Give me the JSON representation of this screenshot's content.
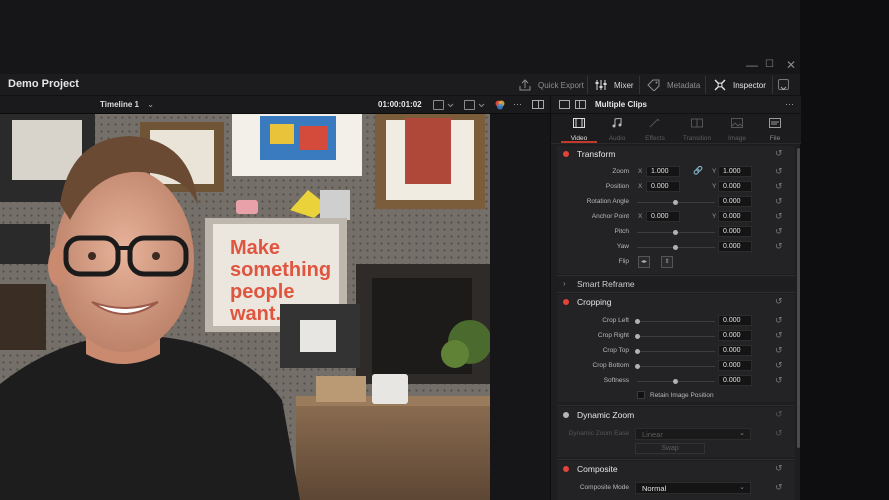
{
  "window": {
    "minimize": "—",
    "maximize": "☐",
    "close": "✕"
  },
  "header": {
    "project_title": "Demo Project",
    "quick_export": "Quick Export",
    "mixer": "Mixer",
    "metadata": "Metadata",
    "inspector": "Inspector"
  },
  "viewer": {
    "timeline_name": "Timeline 1",
    "timeline_chevron": "⌄",
    "timecode": "01:00:01:02",
    "more": "···",
    "poster_text": [
      "Make",
      "something",
      "people",
      "want."
    ]
  },
  "inspector": {
    "title": "Multiple Clips",
    "more": "···",
    "tabs": [
      {
        "label": "Video",
        "active": true
      },
      {
        "label": "Audio",
        "active": false
      },
      {
        "label": "Effects",
        "active": false
      },
      {
        "label": "Transition",
        "active": false
      },
      {
        "label": "Image",
        "active": false
      },
      {
        "label": "File",
        "active": false
      }
    ],
    "transform": {
      "label": "Transform",
      "zoom": {
        "label": "Zoom",
        "x_axis": "X",
        "x": "1.000",
        "y_axis": "Y",
        "y": "1.000"
      },
      "position": {
        "label": "Position",
        "x_axis": "X",
        "x": "0.000",
        "y_axis": "Y",
        "y": "0.000"
      },
      "rotation": {
        "label": "Rotation Angle",
        "value": "0.000"
      },
      "anchor": {
        "label": "Anchor Point",
        "x_axis": "X",
        "x": "0.000",
        "y_axis": "Y",
        "y": "0.000"
      },
      "pitch": {
        "label": "Pitch",
        "value": "0.000"
      },
      "yaw": {
        "label": "Yaw",
        "value": "0.000"
      },
      "flip": {
        "label": "Flip"
      }
    },
    "smart_reframe": {
      "label": "Smart Reframe"
    },
    "cropping": {
      "label": "Cropping",
      "crop_left": {
        "label": "Crop Left",
        "value": "0.000"
      },
      "crop_right": {
        "label": "Crop Right",
        "value": "0.000"
      },
      "crop_top": {
        "label": "Crop Top",
        "value": "0.000"
      },
      "crop_bottom": {
        "label": "Crop Bottom",
        "value": "0.000"
      },
      "softness": {
        "label": "Softness",
        "value": "0.000"
      },
      "retain": "Retain Image Position"
    },
    "dynamic_zoom": {
      "label": "Dynamic Zoom",
      "ease_label": "Dynamic Zoom Ease",
      "ease_value": "Linear",
      "swap": "Swap"
    },
    "composite": {
      "label": "Composite",
      "mode_label": "Composite Mode",
      "mode_value": "Normal"
    }
  },
  "colors": {
    "accent_red": "#e2443a",
    "panel": "#1e1e20"
  }
}
